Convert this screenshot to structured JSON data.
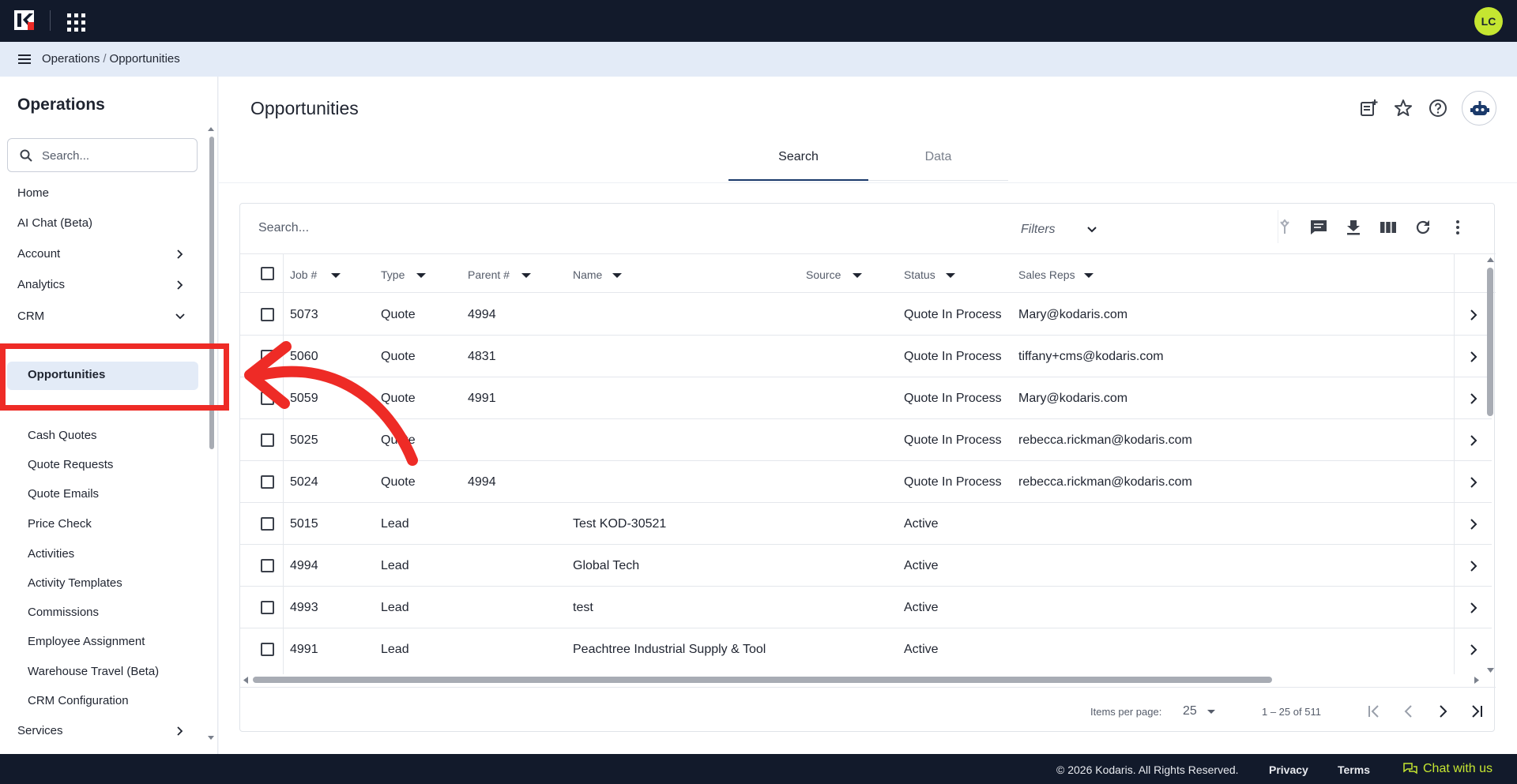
{
  "topbar": {
    "avatar_initials": "LC"
  },
  "breadcrumb": {
    "parent": "Operations",
    "separator": "/",
    "current": "Opportunities"
  },
  "sidebar": {
    "title": "Operations",
    "search_placeholder": "Search...",
    "items": [
      {
        "label": "Home"
      },
      {
        "label": "AI Chat (Beta)"
      },
      {
        "label": "Account"
      },
      {
        "label": "Analytics"
      },
      {
        "label": "CRM"
      }
    ],
    "crm_children": [
      {
        "label": "Opportunities"
      },
      {
        "label": "Cash Quotes"
      },
      {
        "label": "Quote Requests"
      },
      {
        "label": "Quote Emails"
      },
      {
        "label": "Price Check"
      },
      {
        "label": "Activities"
      },
      {
        "label": "Activity Templates"
      },
      {
        "label": "Commissions"
      },
      {
        "label": "Employee Assignment"
      },
      {
        "label": "Warehouse Travel (Beta)"
      },
      {
        "label": "CRM Configuration"
      }
    ],
    "bottom_item": {
      "label": "Services"
    }
  },
  "main": {
    "title": "Opportunities",
    "tabs": [
      {
        "label": "Search"
      },
      {
        "label": "Data"
      }
    ],
    "grid": {
      "search_placeholder": "Search...",
      "filters_label": "Filters",
      "columns": [
        "Job #",
        "Type",
        "Parent #",
        "Name",
        "Source",
        "Status",
        "Sales Reps"
      ],
      "rows": [
        {
          "job": "5073",
          "type": "Quote",
          "parent": "4994",
          "name": "",
          "source": "",
          "status": "Quote In Process",
          "reps": "Mary@kodaris.com"
        },
        {
          "job": "5060",
          "type": "Quote",
          "parent": "4831",
          "name": "",
          "source": "",
          "status": "Quote In Process",
          "reps": "tiffany+cms@kodaris.com"
        },
        {
          "job": "5059",
          "type": "Quote",
          "parent": "4991",
          "name": "",
          "source": "",
          "status": "Quote In Process",
          "reps": "Mary@kodaris.com"
        },
        {
          "job": "5025",
          "type": "Quote",
          "parent": "",
          "name": "",
          "source": "",
          "status": "Quote In Process",
          "reps": "rebecca.rickman@kodaris.com"
        },
        {
          "job": "5024",
          "type": "Quote",
          "parent": "4994",
          "name": "",
          "source": "",
          "status": "Quote In Process",
          "reps": "rebecca.rickman@kodaris.com"
        },
        {
          "job": "5015",
          "type": "Lead",
          "parent": "",
          "name": "Test KOD-30521",
          "source": "",
          "status": "Active",
          "reps": ""
        },
        {
          "job": "4994",
          "type": "Lead",
          "parent": "",
          "name": "Global Tech",
          "source": "",
          "status": "Active",
          "reps": ""
        },
        {
          "job": "4993",
          "type": "Lead",
          "parent": "",
          "name": "test",
          "source": "",
          "status": "Active",
          "reps": ""
        },
        {
          "job": "4991",
          "type": "Lead",
          "parent": "",
          "name": "Peachtree Industrial Supply & Tool",
          "source": "",
          "status": "Active",
          "reps": ""
        }
      ],
      "paginator": {
        "items_per_page_label": "Items per page:",
        "items_per_page": "25",
        "range": "1 – 25 of 511"
      }
    }
  },
  "footer": {
    "copyright": "© 2026 Kodaris. All Rights Reserved.",
    "privacy": "Privacy",
    "terms": "Terms",
    "chat": "Chat with us"
  },
  "colors": {
    "topbar": "#121a2b",
    "accent": "#c5e631",
    "highlight": "#ee2b26",
    "active_nav": "#e3ebf7"
  }
}
